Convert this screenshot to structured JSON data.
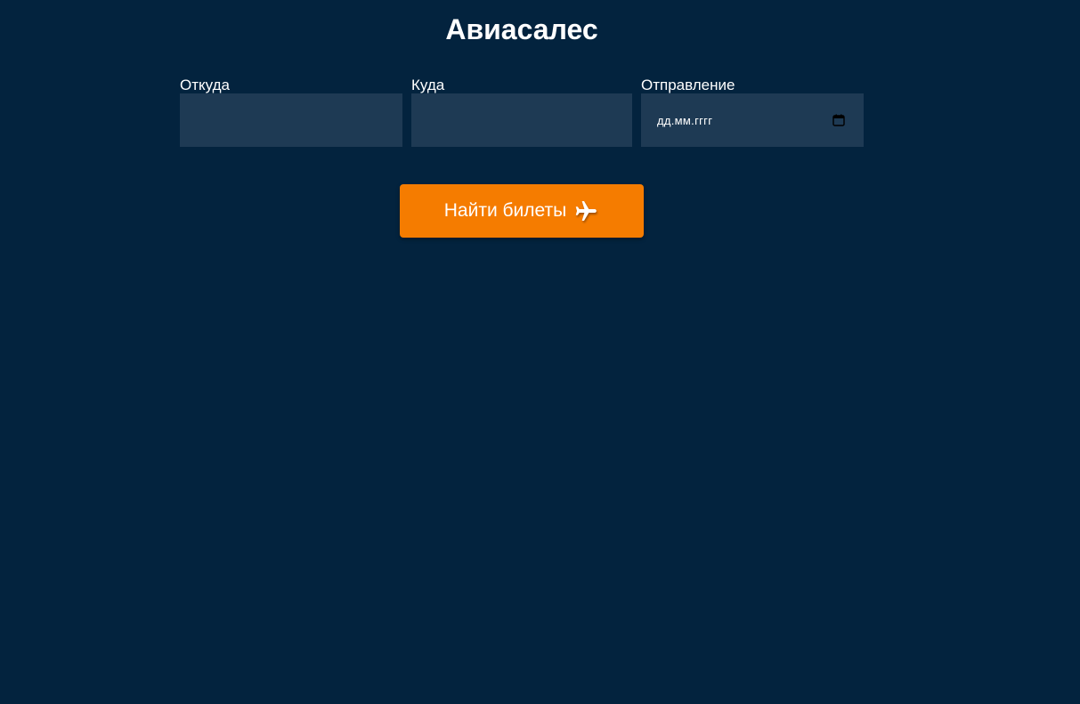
{
  "header": {
    "title": "Авиасалес"
  },
  "form": {
    "from": {
      "label": "Откуда",
      "value": "",
      "placeholder": ""
    },
    "to": {
      "label": "Куда",
      "value": "",
      "placeholder": ""
    },
    "departure": {
      "label": "Отправление",
      "placeholder": "дд.мм.гггг",
      "icon": "calendar-icon"
    }
  },
  "search_button": {
    "label": "Найти билеты",
    "icon": "plane-icon"
  },
  "colors": {
    "background": "#03233e",
    "input_background": "#1e3a54",
    "accent": "#f57c00",
    "text": "#ffffff"
  }
}
